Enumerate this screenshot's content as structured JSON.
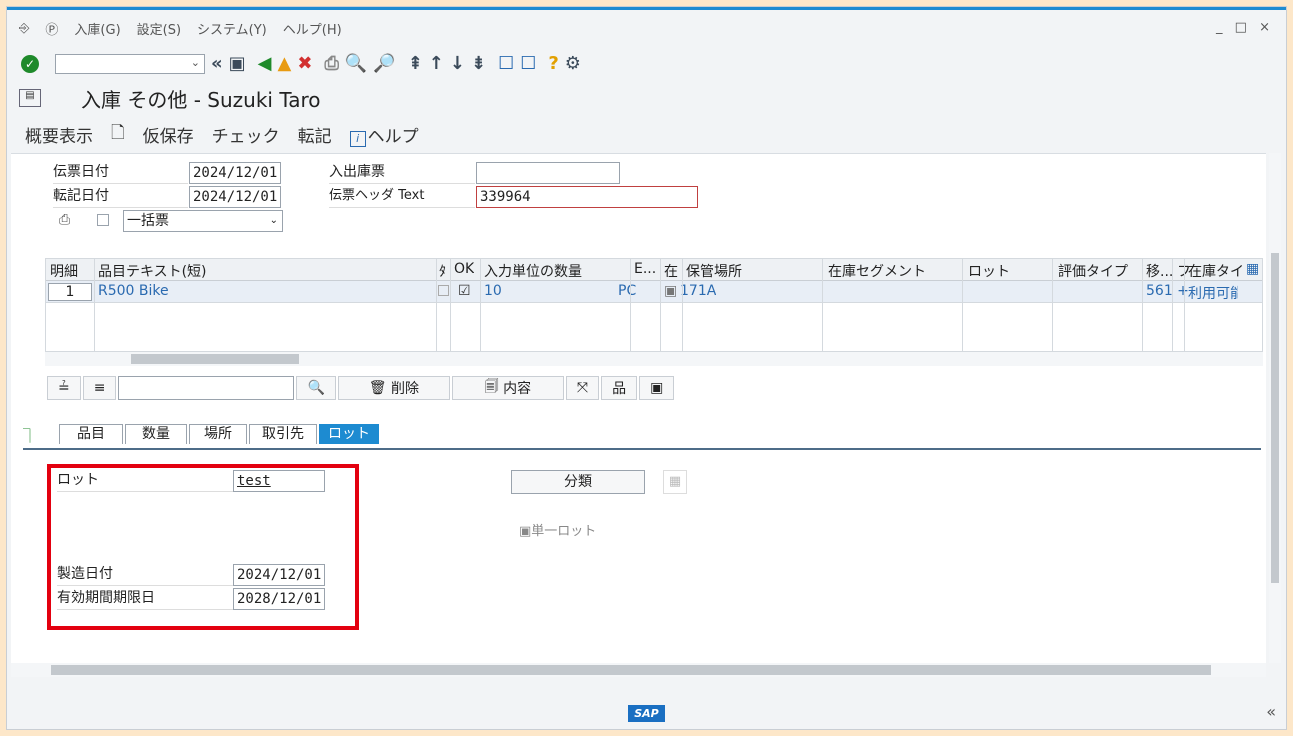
{
  "menu": {
    "items": [
      "入庫(G)",
      "設定(S)",
      "システム(Y)",
      "ヘルプ(H)"
    ],
    "window_controls": "_ □ ×"
  },
  "toolbar": {
    "command_placeholder": ""
  },
  "title": {
    "text": "入庫 その他 - Suzuki Taro"
  },
  "app": {
    "overview": "概要表示",
    "save_draft": "仮保存",
    "check": "チェック",
    "post": "転記",
    "help": "ヘルプ"
  },
  "header": {
    "doc_date_label": "伝票日付",
    "doc_date": "2024/12/01",
    "post_date_label": "転記日付",
    "post_date": "2024/12/01",
    "delivery_label": "入出庫票",
    "delivery": "",
    "header_text_label": "伝票ヘッダ Text",
    "header_text": "339964",
    "slip_option": "一括票"
  },
  "grid": {
    "columns": [
      "明細",
      "品目テキスト(短)",
      "ﾀ",
      "OK",
      "入力単位の数量",
      "E...",
      "在",
      "保管場所",
      "在庫セグメント",
      "ロット",
      "評価タイプ",
      "移...",
      "フ",
      "在庫タイ"
    ],
    "row": {
      "item": "1",
      "text": "R500 Bike",
      "qty": "10",
      "unit": "PC",
      "sloc": "171A",
      "mvt": "561 +",
      "stock_type": "利用可能"
    }
  },
  "gridtools": {
    "delete": "削除",
    "contents": "内容"
  },
  "tabs": [
    "品目",
    "数量",
    "場所",
    "取引先",
    "ロット"
  ],
  "lot": {
    "lot_label": "ロット",
    "lot": "test",
    "mfg_label": "製造日付",
    "mfg": "2024/12/01",
    "exp_label": "有効期間期限日",
    "exp": "2028/12/01",
    "classify": "分類",
    "single_lot": "単一ロット"
  },
  "status": {
    "logo": "SAP"
  }
}
